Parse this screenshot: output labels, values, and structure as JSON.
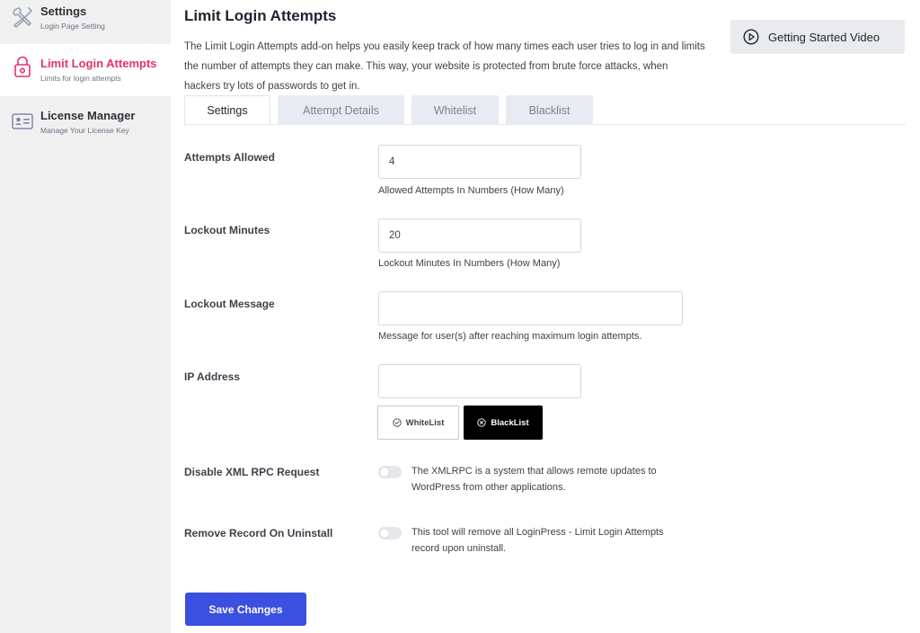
{
  "sidebar": {
    "items": [
      {
        "title": "Settings",
        "subtitle": "Login Page Setting",
        "icon": "tools-icon"
      },
      {
        "title": "Limit Login Attempts",
        "subtitle": "Limits for login attempts",
        "icon": "lock-icon"
      },
      {
        "title": "License Manager",
        "subtitle": "Manage Your License Key",
        "icon": "id-card-icon"
      }
    ],
    "active_index": 1
  },
  "header": {
    "title": "Limit Login Attempts",
    "description": "The Limit Login Attempts add-on helps you easily keep track of how many times each user tries to log in and limits the number of attempts they can make. This way, your website is protected from brute force attacks, when hackers try lots of passwords to get in.",
    "video_button": "Getting Started Video"
  },
  "tabs": [
    {
      "label": "Settings",
      "active": true
    },
    {
      "label": "Attempt Details",
      "active": false
    },
    {
      "label": "Whitelist",
      "active": false
    },
    {
      "label": "Blacklist",
      "active": false
    }
  ],
  "form": {
    "attempts_allowed": {
      "label": "Attempts Allowed",
      "value": "4",
      "help": "Allowed Attempts In Numbers (How Many)"
    },
    "lockout_minutes": {
      "label": "Lockout Minutes",
      "value": "20",
      "help": "Lockout Minutes In Numbers (How Many)"
    },
    "lockout_message": {
      "label": "Lockout Message",
      "value": "",
      "help": "Message for user(s) after reaching maximum login attempts."
    },
    "ip_address": {
      "label": "IP Address",
      "value": "",
      "whitelist_label": "WhiteList",
      "blacklist_label": "BlackList"
    },
    "disable_xmlrpc": {
      "label": "Disable XML RPC Request",
      "enabled": false,
      "description": "The XMLRPC is a system that allows remote updates to WordPress from other applications."
    },
    "remove_record": {
      "label": "Remove Record On Uninstall",
      "enabled": false,
      "description": "This tool will remove all LoginPress - Limit Login Attempts record upon uninstall."
    }
  },
  "save_button": "Save Changes",
  "colors": {
    "accent_pink": "#e5326b",
    "primary_blue": "#3b4fe0",
    "sidebar_bg": "#f0f0f1"
  }
}
